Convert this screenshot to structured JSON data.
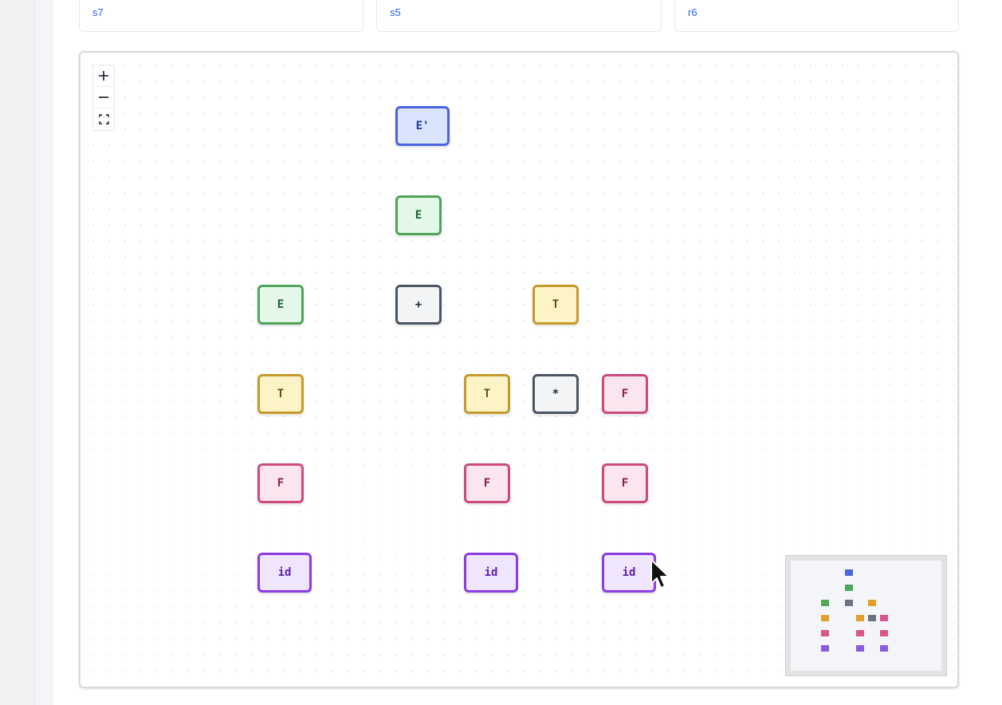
{
  "action_cards": [
    {
      "value": "s7"
    },
    {
      "value": "s5"
    },
    {
      "value": "r6"
    }
  ],
  "zoom_controls": {
    "zoom_in": "+",
    "zoom_out": "−"
  },
  "tree": {
    "nodes": {
      "root": "E'",
      "e_mid": "E",
      "e_left": "E",
      "plus": "+",
      "t_right": "T",
      "t_left": "T",
      "t_mid": "T",
      "star": "*",
      "f_right": "F",
      "f_left": "F",
      "f_mid": "F",
      "f_right_low": "F",
      "id_left": "id",
      "id_mid": "id",
      "id_right": "id"
    }
  },
  "colors": {
    "start": "#4b63e0",
    "nonterminal_E": "#4fa65a",
    "operator": "#4b5563",
    "nonterminal_T": "#c49a2d",
    "nonterminal_F": "#cc4a7f",
    "terminal_id": "#8a3de0"
  },
  "icons": [
    "plus-icon",
    "minus-icon",
    "fit-view-icon",
    "mouse-pointer-icon"
  ]
}
